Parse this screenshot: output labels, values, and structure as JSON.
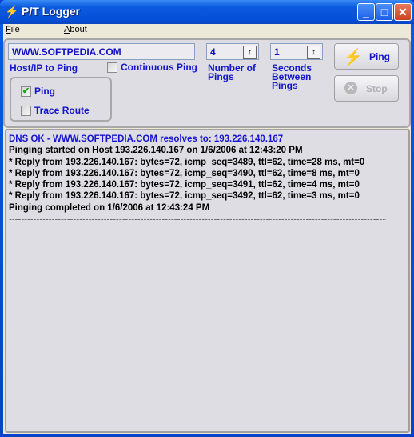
{
  "window": {
    "title": "P/T Logger",
    "minimize": "_",
    "maximize": "□",
    "close": "✕"
  },
  "menu": [
    {
      "label": "File",
      "mnemonic": "F"
    },
    {
      "label": "About",
      "mnemonic": "A"
    }
  ],
  "host": {
    "value": "WWW.SOFTPEDIA.COM",
    "label": "Host/IP to Ping"
  },
  "continuous": {
    "label": "Continuous Ping",
    "checked": false
  },
  "mode": {
    "ping": {
      "label": "Ping",
      "checked": true
    },
    "trace": {
      "label": "Trace Route",
      "checked": false
    }
  },
  "num_pings": {
    "value": "4",
    "label_lines": [
      "Number of",
      "Pings"
    ]
  },
  "seconds": {
    "value": "1",
    "label_lines": [
      "Seconds",
      "Between",
      "Pings"
    ]
  },
  "buttons": {
    "ping": "Ping",
    "stop": "Stop",
    "stop_enabled": false
  },
  "log": [
    "DNS OK - WWW.SOFTPEDIA.COM resolves to: 193.226.140.167",
    "Pinging started on Host 193.226.140.167 on 1/6/2006 at 12:43:20 PM",
    "* Reply from 193.226.140.167: bytes=72, icmp_seq=3489, ttl=62, time=28 ms, mt=0",
    "* Reply from 193.226.140.167: bytes=72, icmp_seq=3490, ttl=62, time=8 ms, mt=0",
    "* Reply from 193.226.140.167: bytes=72, icmp_seq=3491, ttl=62, time=4 ms, mt=0",
    "* Reply from 193.226.140.167: bytes=72, icmp_seq=3492, ttl=62, time=3 ms, mt=0",
    "Pinging completed on 1/6/2006 at 12:43:24 PM",
    "----------------------------------------------------------------------------------------------------------------------------------------"
  ],
  "colors": {
    "label": "#1414d0",
    "titlebar": "#0a5ae0"
  }
}
